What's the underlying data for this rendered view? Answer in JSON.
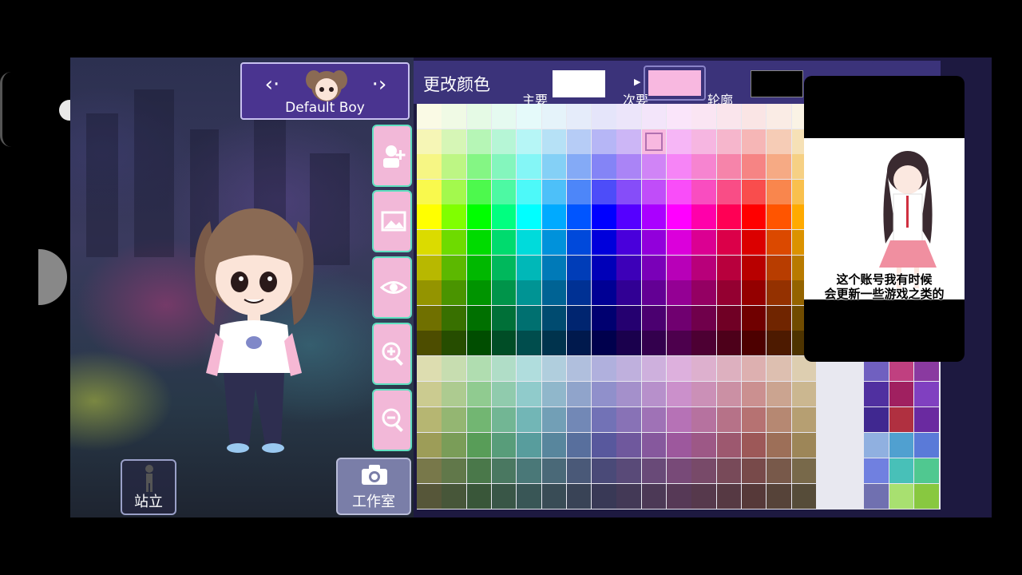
{
  "character_selector": {
    "name": "Default Boy",
    "prev_icon": "chevron-left-icon",
    "next_icon": "chevron-right-icon"
  },
  "side_tools": [
    {
      "name": "add-character-button",
      "icon": "person-plus-icon"
    },
    {
      "name": "background-button",
      "icon": "image-icon"
    },
    {
      "name": "hide-ui-button",
      "icon": "eye-icon"
    },
    {
      "name": "zoom-in-button",
      "icon": "zoom-in-icon"
    },
    {
      "name": "zoom-out-button",
      "icon": "zoom-out-icon"
    }
  ],
  "bottom": {
    "pose_label": "站立",
    "studio_label": "工作室"
  },
  "color_panel": {
    "title": "更改颜色",
    "primary_label": "主要",
    "secondary_label": "次要",
    "outline_label": "轮廓",
    "primary_color": "#ffffff",
    "secondary_color": "#f8b8e0",
    "outline_color": "#000000",
    "selected_color": "#f8b8e0"
  },
  "video_overlay": {
    "caption_line1": "这个账号我有时候",
    "caption_line2": "会更新一些游戏之类的"
  }
}
